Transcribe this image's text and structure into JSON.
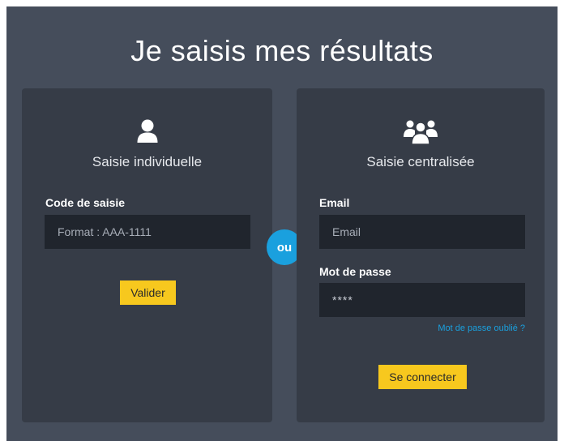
{
  "page": {
    "title": "Je saisis mes résultats",
    "separator": "ou"
  },
  "individual": {
    "icon": "user-icon",
    "heading": "Saisie individuelle",
    "code_label": "Code de saisie",
    "code_placeholder": "Format : AAA-1111",
    "submit_label": "Valider"
  },
  "centralized": {
    "icon": "users-group-icon",
    "heading": "Saisie centralisée",
    "email_label": "Email",
    "email_placeholder": "Email",
    "password_label": "Mot de passe",
    "password_value": "****",
    "forgot_link": "Mot de passe oublié ?",
    "submit_label": "Se connecter"
  },
  "colors": {
    "background": "#454d5b",
    "card": "#363c47",
    "input": "#20252d",
    "accent_button": "#f7c81e",
    "accent_link": "#1aa0de"
  }
}
